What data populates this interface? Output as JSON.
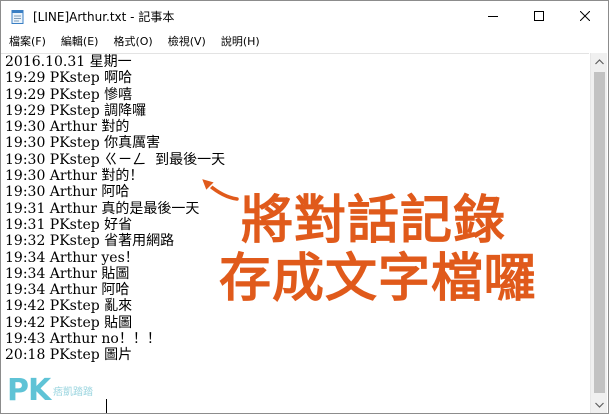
{
  "window": {
    "title": "[LINE]Arthur.txt - 記事本"
  },
  "menu": [
    {
      "label": "檔案(F)"
    },
    {
      "label": "編輯(E)"
    },
    {
      "label": "格式(O)"
    },
    {
      "label": "檢視(V)"
    },
    {
      "label": "說明(H)"
    }
  ],
  "editor": {
    "lines": [
      "2016.10.31 星期一",
      "19:29 PKstep 啊哈",
      "19:29 PKstep 慘嘻",
      "19:29 PKstep 調降囉",
      "19:30 Arthur 對的",
      "19:30 PKstep 你真厲害",
      "19:30 PKstep ㄍㄧㄥ  到最後一天",
      "19:30 Arthur 對的！",
      "19:30 Arthur 阿哈",
      "19:31 Arthur 真的是最後一天",
      "19:31 PKstep 好省",
      "19:32 PKstep 省著用網路",
      "19:34 Arthur yes！",
      "19:34 Arthur 貼圖",
      "19:34 Arthur 阿哈",
      "19:42 PKstep 亂來",
      "19:42 PKstep 貼圖",
      "19:43 Arthur no！！！",
      "20:18 PKstep 圖片"
    ]
  },
  "overlay": {
    "line1": "將對話記錄",
    "line2": "存成文字檔囉",
    "color": "#e05a1b"
  },
  "watermark": {
    "logo": "PK",
    "caption": "痞凱踏踏"
  },
  "icons": {
    "app": "notepad-icon",
    "minimize": "minimize-icon",
    "maximize": "maximize-icon",
    "close": "close-icon",
    "scroll_up": "scroll-up-arrow-icon",
    "scroll_down": "scroll-down-arrow-icon",
    "annotation_arrow": "arrow-icon"
  }
}
